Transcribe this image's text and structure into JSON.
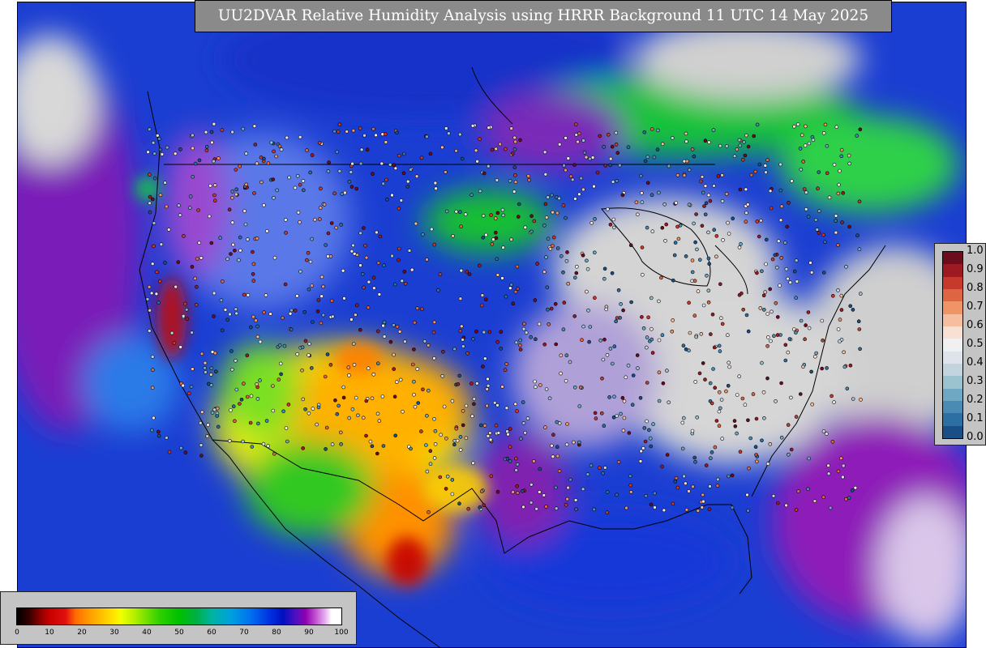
{
  "title": "UU2DVAR Relative Humidity Analysis using HRRR Background 11 UTC 14 May 2025",
  "obs_colorbar": {
    "tick_labels": [
      "1.0",
      "0.9",
      "0.8",
      "0.7",
      "0.6",
      "0.5",
      "0.4",
      "0.3",
      "0.2",
      "0.1",
      "0.0"
    ],
    "colors": [
      "#6b0d1d",
      "#9e1a23",
      "#c63a2b",
      "#dd6541",
      "#ee9467",
      "#f5bea0",
      "#f8e1d3",
      "#f0f0f0",
      "#dfe4ea",
      "#c2d5df",
      "#9bc2cf",
      "#6fa8c2",
      "#4a8bb3",
      "#2c6fa2",
      "#1a4f86"
    ]
  },
  "analysis_colorbar": {
    "tick_labels": [
      "0",
      "10",
      "20",
      "30",
      "40",
      "50",
      "60",
      "70",
      "80",
      "90",
      "100"
    ]
  }
}
